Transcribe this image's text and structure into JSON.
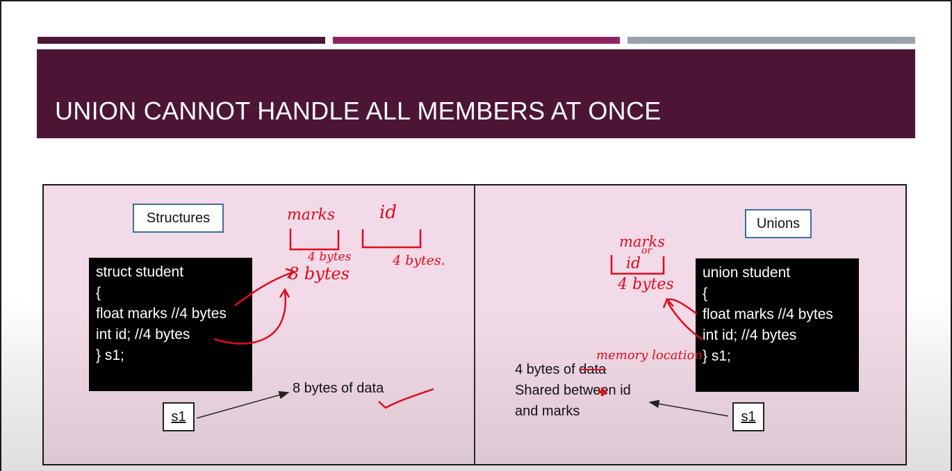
{
  "slide": {
    "title": "UNION CANNOT HANDLE ALL MEMBERS AT ONCE"
  },
  "left": {
    "heading": "Structures",
    "code_lines": [
      "struct student",
      "{",
      "float marks //4 bytes",
      "int id; //4 bytes",
      "} s1;"
    ],
    "var_label": "s1",
    "note": "8 bytes of data",
    "annotations": {
      "marks": "marks",
      "id": "id",
      "marks_size": "4 bytes",
      "id_size": "4 bytes.",
      "total": "8 bytes"
    }
  },
  "right": {
    "heading": "Unions",
    "code_lines": [
      "union student",
      "{",
      "float marks //4 bytes",
      "int id; //4 bytes",
      "} s1;"
    ],
    "var_label": "s1",
    "note_line1_a": "4 bytes of ",
    "note_line1_b": "data",
    "note_line2": "Shared between id",
    "note_line3": "and marks",
    "annotations": {
      "marks": "marks",
      "or": "or",
      "id": "id",
      "size": "4 bytes",
      "memory": "memory location"
    }
  },
  "colors": {
    "title_bar": "#4c1536",
    "content_bg": "#f3dae8",
    "ink": "#e00b1c"
  }
}
